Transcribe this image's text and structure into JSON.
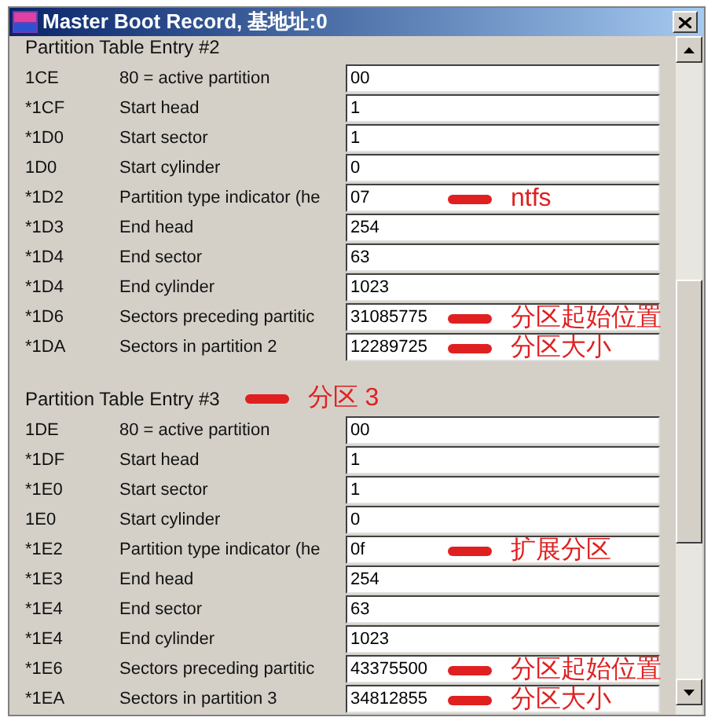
{
  "window": {
    "title": "Master Boot Record, 基地址:0"
  },
  "sections": [
    {
      "heading": "Partition Table Entry #2",
      "rows": [
        {
          "offset": "1CE",
          "label": "80 = active partition",
          "value": "00"
        },
        {
          "offset": "*1CF",
          "label": "Start head",
          "value": "1"
        },
        {
          "offset": "*1D0",
          "label": "Start sector",
          "value": "1"
        },
        {
          "offset": "1D0",
          "label": "Start cylinder",
          "value": "0"
        },
        {
          "offset": "*1D2",
          "label": "Partition type indicator (he",
          "value": "07",
          "note": "ntfs"
        },
        {
          "offset": "*1D3",
          "label": "End head",
          "value": "254"
        },
        {
          "offset": "*1D4",
          "label": "End sector",
          "value": "63"
        },
        {
          "offset": "*1D4",
          "label": "End cylinder",
          "value": "1023"
        },
        {
          "offset": "*1D6",
          "label": "Sectors preceding partitic",
          "value": "31085775",
          "note": "分区起始位置"
        },
        {
          "offset": "*1DA",
          "label": "Sectors in partition 2",
          "value": "12289725",
          "note": "分区大小"
        }
      ]
    },
    {
      "heading": "Partition Table Entry #3",
      "note": "分区 3",
      "rows": [
        {
          "offset": "1DE",
          "label": "80 = active partition",
          "value": "00"
        },
        {
          "offset": "*1DF",
          "label": "Start head",
          "value": "1"
        },
        {
          "offset": "*1E0",
          "label": "Start sector",
          "value": "1"
        },
        {
          "offset": "1E0",
          "label": "Start cylinder",
          "value": "0"
        },
        {
          "offset": "*1E2",
          "label": "Partition type indicator (he",
          "value": "0f",
          "note": "扩展分区"
        },
        {
          "offset": "*1E3",
          "label": "End head",
          "value": "254"
        },
        {
          "offset": "*1E4",
          "label": "End sector",
          "value": "63"
        },
        {
          "offset": "*1E4",
          "label": "End cylinder",
          "value": "1023"
        },
        {
          "offset": "*1E6",
          "label": "Sectors preceding partitic",
          "value": "43375500",
          "note": "分区起始位置"
        },
        {
          "offset": "*1EA",
          "label": "Sectors in partition 3",
          "value": "34812855",
          "note": "分区大小"
        }
      ]
    }
  ]
}
